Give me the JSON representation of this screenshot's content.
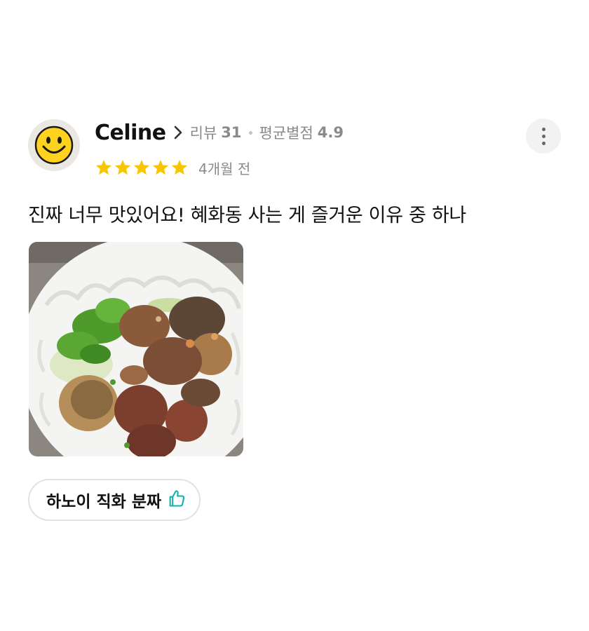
{
  "review": {
    "user": {
      "name": "Celine",
      "avatar_icon": "smiley-face-icon"
    },
    "stats": {
      "review_label": "리뷰",
      "review_count": "31",
      "avg_label": "평균별점",
      "avg_value": "4.9"
    },
    "rating": 5,
    "rating_max": 5,
    "time_ago": "4개월 전",
    "text": "진짜 너무 맛있어요! 혜화동 사는 게 즐거운 이유 중 하나",
    "photo": {
      "icon": "food-photo-bun-cha"
    },
    "tag": {
      "label": "하노이 직화 분짜",
      "icon": "thumbs-up-icon"
    },
    "more_icon": "more-vertical-icon"
  },
  "colors": {
    "star": "#F7C600",
    "tag_icon": "#12B3A8",
    "meta_text": "#8A8A8A",
    "text": "#111111"
  }
}
